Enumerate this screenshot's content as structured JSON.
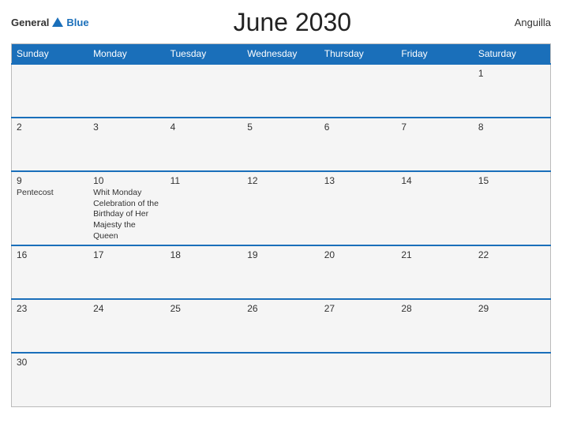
{
  "header": {
    "logo_general": "General",
    "logo_blue": "Blue",
    "title": "June 2030",
    "country": "Anguilla"
  },
  "days_of_week": [
    "Sunday",
    "Monday",
    "Tuesday",
    "Wednesday",
    "Thursday",
    "Friday",
    "Saturday"
  ],
  "weeks": [
    [
      {
        "day": "",
        "event": ""
      },
      {
        "day": "",
        "event": ""
      },
      {
        "day": "",
        "event": ""
      },
      {
        "day": "",
        "event": ""
      },
      {
        "day": "",
        "event": ""
      },
      {
        "day": "",
        "event": ""
      },
      {
        "day": "1",
        "event": ""
      }
    ],
    [
      {
        "day": "2",
        "event": ""
      },
      {
        "day": "3",
        "event": ""
      },
      {
        "day": "4",
        "event": ""
      },
      {
        "day": "5",
        "event": ""
      },
      {
        "day": "6",
        "event": ""
      },
      {
        "day": "7",
        "event": ""
      },
      {
        "day": "8",
        "event": ""
      }
    ],
    [
      {
        "day": "9",
        "event": "Pentecost"
      },
      {
        "day": "10",
        "event": "Whit Monday\n  Celebration of the Birthday of Her Majesty the Queen"
      },
      {
        "day": "11",
        "event": ""
      },
      {
        "day": "12",
        "event": ""
      },
      {
        "day": "13",
        "event": ""
      },
      {
        "day": "14",
        "event": ""
      },
      {
        "day": "15",
        "event": ""
      }
    ],
    [
      {
        "day": "16",
        "event": ""
      },
      {
        "day": "17",
        "event": ""
      },
      {
        "day": "18",
        "event": ""
      },
      {
        "day": "19",
        "event": ""
      },
      {
        "day": "20",
        "event": ""
      },
      {
        "day": "21",
        "event": ""
      },
      {
        "day": "22",
        "event": ""
      }
    ],
    [
      {
        "day": "23",
        "event": ""
      },
      {
        "day": "24",
        "event": ""
      },
      {
        "day": "25",
        "event": ""
      },
      {
        "day": "26",
        "event": ""
      },
      {
        "day": "27",
        "event": ""
      },
      {
        "day": "28",
        "event": ""
      },
      {
        "day": "29",
        "event": ""
      }
    ],
    [
      {
        "day": "30",
        "event": ""
      },
      {
        "day": "",
        "event": ""
      },
      {
        "day": "",
        "event": ""
      },
      {
        "day": "",
        "event": ""
      },
      {
        "day": "",
        "event": ""
      },
      {
        "day": "",
        "event": ""
      },
      {
        "day": "",
        "event": ""
      }
    ]
  ]
}
